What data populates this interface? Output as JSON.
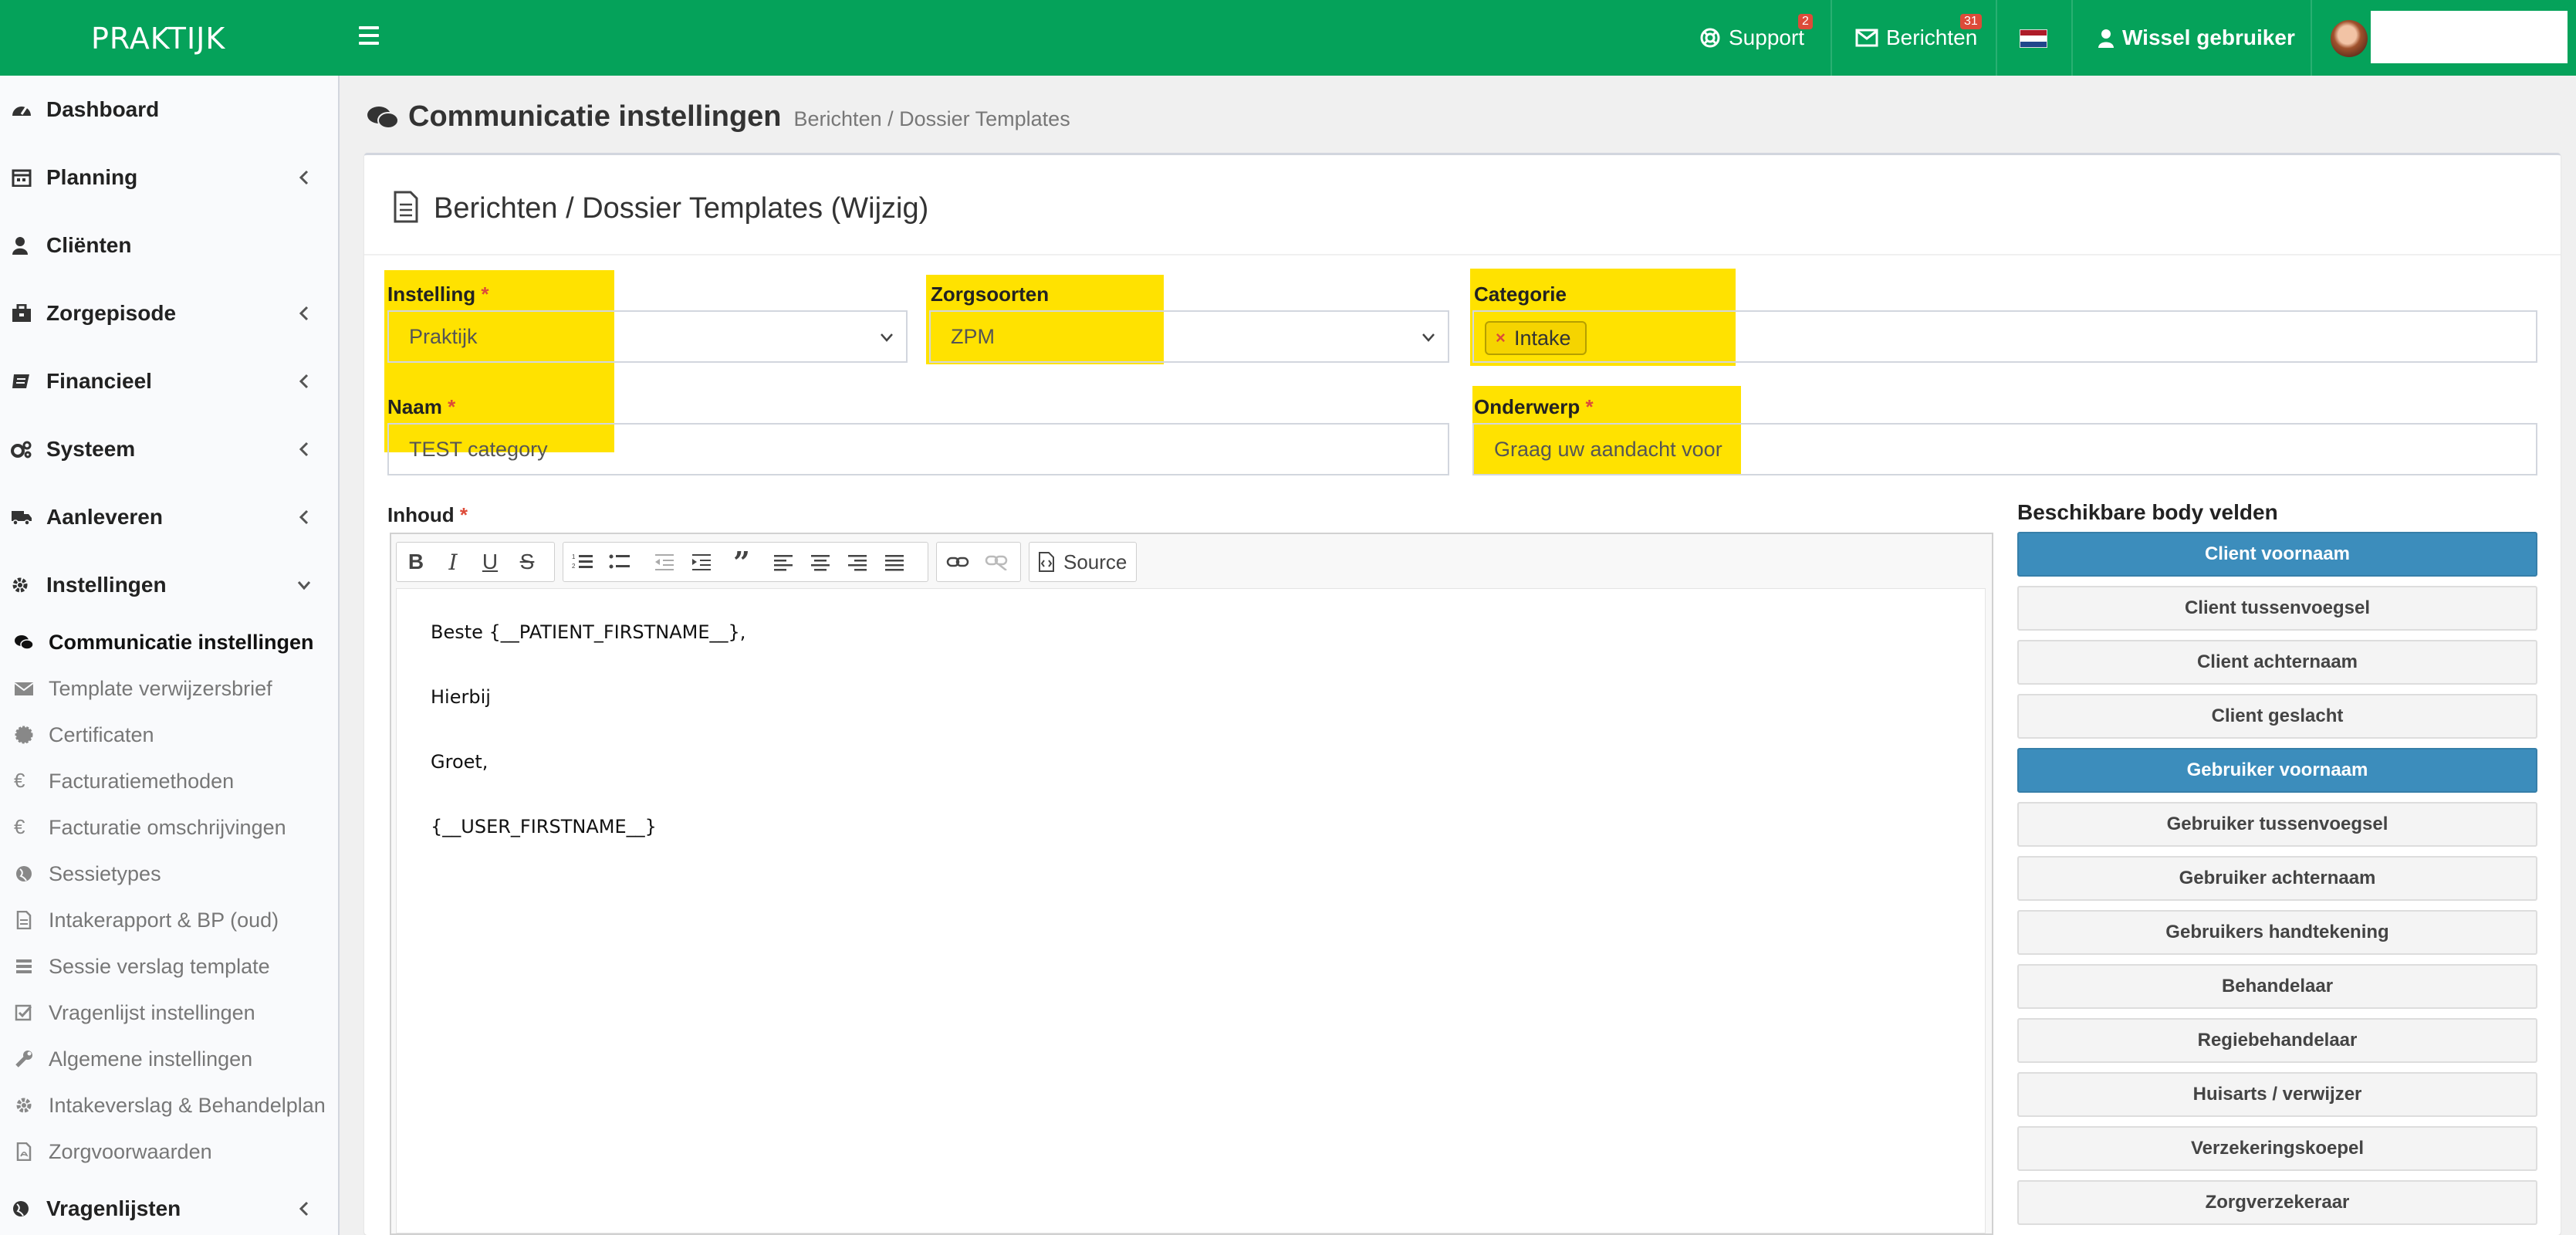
{
  "topbar": {
    "brand": "PRAKTIJK",
    "support_label": "Support",
    "support_badge": "2",
    "messages_label": "Berichten",
    "messages_badge": "31",
    "switch_user_label": "Wissel gebruiker",
    "accent_color": "#05a25a"
  },
  "sidebar": {
    "main_items": [
      {
        "label": "Dashboard",
        "icon": "dashboard-icon"
      },
      {
        "label": "Planning",
        "icon": "calendar-icon"
      },
      {
        "label": "Cliënten",
        "icon": "user-icon"
      },
      {
        "label": "Zorgepisode",
        "icon": "briefcase-icon"
      },
      {
        "label": "Financieel",
        "icon": "book-icon"
      },
      {
        "label": "Systeem",
        "icon": "gears-icon"
      },
      {
        "label": "Aanleveren",
        "icon": "truck-icon"
      },
      {
        "label": "Instellingen",
        "icon": "gear-icon"
      }
    ],
    "sub_items": [
      {
        "label": "Communicatie instellingen",
        "icon": "comments-icon",
        "active": true
      },
      {
        "label": "Template verwijzersbrief",
        "icon": "envelope-icon"
      },
      {
        "label": "Certificaten",
        "icon": "certificate-icon"
      },
      {
        "label": "Facturatiemethoden",
        "icon": "euro-icon"
      },
      {
        "label": "Facturatie omschrijvingen",
        "icon": "euro-icon"
      },
      {
        "label": "Sessietypes",
        "icon": "globe-icon"
      },
      {
        "label": "Intakerapport & BP (oud)",
        "icon": "file-icon"
      },
      {
        "label": "Sessie verslag template",
        "icon": "list-icon"
      },
      {
        "label": "Vragenlijst instellingen",
        "icon": "checkbox-icon"
      },
      {
        "label": "Algemene instellingen",
        "icon": "wrench-icon"
      },
      {
        "label": "Intakeverslag & Behandelplan",
        "icon": "gear-icon"
      },
      {
        "label": "Zorgvoorwaarden",
        "icon": "pdf-icon"
      }
    ],
    "last_item": {
      "label": "Vragenlijsten",
      "icon": "globe-icon"
    }
  },
  "page": {
    "title": "Communicatie instellingen",
    "breadcrumb": "Berichten / Dossier Templates"
  },
  "form": {
    "box_title": "Berichten / Dossier Templates (Wijzig)",
    "required_mark": "*",
    "instelling": {
      "label": "Instelling",
      "value": "Praktijk"
    },
    "zorgsoorten": {
      "label": "Zorgsoorten",
      "value": "ZPM"
    },
    "categorie": {
      "label": "Categorie",
      "tag_remove": "×",
      "tag": "Intake"
    },
    "naam": {
      "label": "Naam",
      "value": "TEST category"
    },
    "onderwerp": {
      "label": "Onderwerp",
      "value": "Graag uw aandacht voor"
    },
    "inhoud": {
      "label": "Inhoud"
    },
    "highlight_color": "#ffe200"
  },
  "editor": {
    "source_label": "Source",
    "lines": [
      "Beste {__PATIENT_FIRSTNAME__},",
      "Hierbij",
      "Groet,",
      "{__USER_FIRSTNAME__}"
    ]
  },
  "body_fields": {
    "title": "Beschikbare body velden",
    "items": [
      {
        "label": "Client voornaam",
        "primary": true
      },
      {
        "label": "Client tussenvoegsel"
      },
      {
        "label": "Client achternaam"
      },
      {
        "label": "Client geslacht"
      },
      {
        "label": "Gebruiker voornaam",
        "primary": true
      },
      {
        "label": "Gebruiker tussenvoegsel"
      },
      {
        "label": "Gebruiker achternaam"
      },
      {
        "label": "Gebruikers handtekening"
      },
      {
        "label": "Behandelaar"
      },
      {
        "label": "Regiebehandelaar"
      },
      {
        "label": "Huisarts / verwijzer"
      },
      {
        "label": "Verzekeringskoepel"
      },
      {
        "label": "Zorgverzekeraar"
      }
    ],
    "primary_color": "#3c8dbc"
  }
}
